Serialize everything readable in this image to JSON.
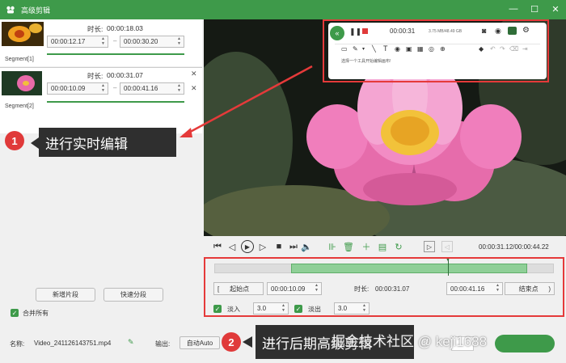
{
  "window": {
    "title": "高级剪辑"
  },
  "segments": [
    {
      "label": "Segment[1]",
      "duration_label": "时长:",
      "duration": "00:00:18.03",
      "start": "00:00:12.17",
      "end": "00:00:30.20"
    },
    {
      "label": "Segment[2]",
      "duration_label": "时长:",
      "duration": "00:00:31.07",
      "start": "00:00:10.09",
      "end": "00:00:41.16"
    }
  ],
  "left_buttons": {
    "new_segment": "新增片段",
    "quick_split": "快速分段"
  },
  "merge_all": "合并所有",
  "overlay": {
    "time": "00:00:31",
    "storage": "3.75 MB/48.49 GB",
    "hint": "选择一个工具开始编辑画布!"
  },
  "player": {
    "time": "00:00:31.12/00:00:44.22"
  },
  "clip": {
    "start_label": "起始点",
    "start": "00:00:10.09",
    "duration_label": "时长:",
    "duration": "00:00:31.07",
    "end": "00:00:41.16",
    "end_label": "结束点",
    "fade_in_label": "淡入",
    "fade_in": "3.0",
    "fade_out_label": "淡出",
    "fade_out": "3.0"
  },
  "bottom": {
    "name_label": "名称:",
    "filename": "Video_241126143751.mp4",
    "output_label": "输出:",
    "output_value": "自动Auto"
  },
  "annotations": {
    "one": "1",
    "one_text": "进行实时编辑",
    "two": "2",
    "two_text": "进行后期高级剪辑"
  },
  "watermark": "掘金技术社区 @ keji1688",
  "colors": {
    "accent": "#3e9a4a",
    "callout_red": "#e53a3a"
  }
}
